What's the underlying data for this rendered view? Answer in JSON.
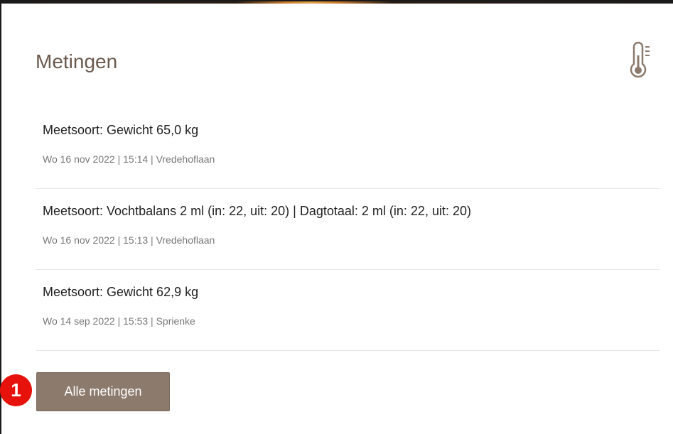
{
  "card": {
    "title": "Metingen",
    "icon": "thermometer-icon",
    "accent_color": "#8c7a6d",
    "title_color": "#6b5a4e"
  },
  "measurements": [
    {
      "title": "Meetsoort: Gewicht 65,0 kg",
      "meta": "Wo 16 nov 2022 | 15:14 | Vredehoflaan"
    },
    {
      "title": "Meetsoort: Vochtbalans 2 ml (in: 22, uit: 20) | Dagtotaal: 2 ml (in: 22, uit: 20)",
      "meta": "Wo 16 nov 2022 | 15:13 | Vredehoflaan"
    },
    {
      "title": "Meetsoort: Gewicht 62,9 kg",
      "meta": "Wo 14 sep 2022 | 15:53 | Sprienke"
    }
  ],
  "all_button": {
    "label": "Alle metingen"
  },
  "step_badge": {
    "label": "1",
    "color": "#e8120c"
  }
}
